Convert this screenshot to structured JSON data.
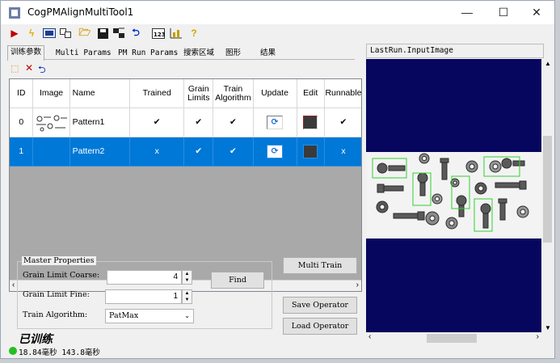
{
  "window": {
    "title": "CogPMAlignMultiTool1",
    "minimize": "—",
    "maximize": "☐",
    "close": "✕"
  },
  "toolbar": [
    "run-icon",
    "lightning-icon",
    "display-icon",
    "link-icon",
    "open-icon",
    "save-icon",
    "reset-icon",
    "load-icon",
    "image-icon",
    "chart-icon",
    "help-icon"
  ],
  "tabs": [
    "训练参数",
    "Multi Params",
    "PM Run Params",
    "搜索区域",
    "图形",
    "结果"
  ],
  "grid": {
    "headers": [
      "ID",
      "Image",
      "Name",
      "Trained",
      "Grain\nLimits",
      "Train\nAlgorithm",
      "Update",
      "Edit",
      "Runnable"
    ],
    "rows": [
      {
        "id": "0",
        "name": "Pattern1",
        "trained": "✔",
        "grain": "✔",
        "algo": "✔",
        "runnable": "✔"
      },
      {
        "id": "1",
        "name": "Pattern2",
        "trained": "x",
        "grain": "✔",
        "algo": "✔",
        "runnable": "x"
      }
    ]
  },
  "master": {
    "legend": "Master Properties",
    "coarse_label": "Grain Limit Coarse:",
    "coarse_value": "4",
    "fine_label": "Grain Limit Fine:",
    "fine_value": "1",
    "algo_label": "Train Algorithm:",
    "algo_value": "PatMax",
    "find": "Find"
  },
  "buttons": {
    "multi_train": "Multi Train",
    "save_op": "Save Operator",
    "load_op": "Load Operator"
  },
  "trained_label": "已训练",
  "status": "18.84毫秒 143.8毫秒",
  "image_pane": {
    "title": "LastRun.InputImage"
  },
  "colors": {
    "selection": "#0078d7",
    "viewport": "#06065e",
    "match_box": "#2fd12f"
  }
}
